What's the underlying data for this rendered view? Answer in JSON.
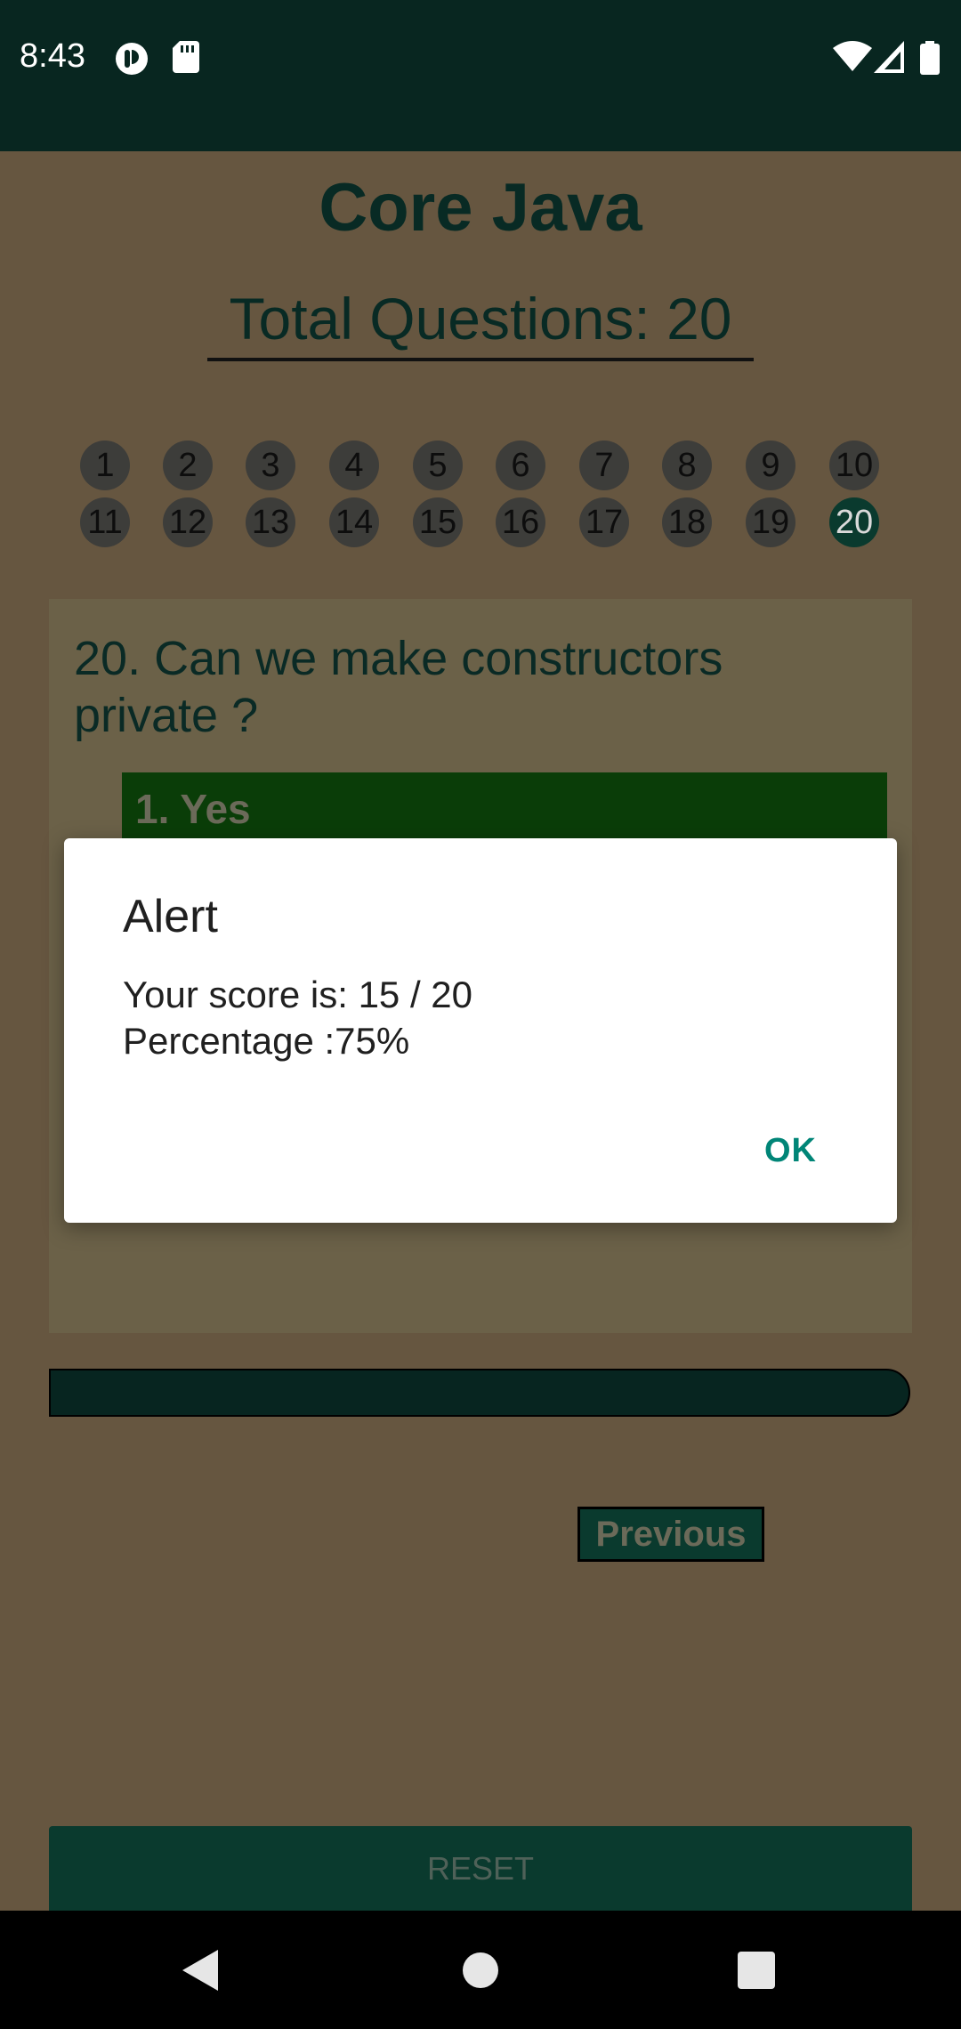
{
  "status_bar": {
    "time": "8:43"
  },
  "app": {
    "title": "Core Java",
    "total_questions_label": "Total Questions: 20",
    "question_numbers": [
      "1",
      "2",
      "3",
      "4",
      "5",
      "6",
      "7",
      "8",
      "9",
      "10",
      "11",
      "12",
      "13",
      "14",
      "15",
      "16",
      "17",
      "18",
      "19",
      "20"
    ],
    "current_question": "20",
    "question_text": "20. Can we make constructors private ?",
    "option_1": "1. Yes",
    "previous_label": "Previous",
    "reset_label": "RESET",
    "progress": 1.0,
    "colors": {
      "background": "#665640",
      "accent": "#0a3a2e",
      "selected_option": "#0a3d08"
    }
  },
  "dialog": {
    "title": "Alert",
    "score_line": "Your score is: 15 / 20",
    "percentage_line": "Percentage :75%",
    "ok_label": "OK"
  }
}
